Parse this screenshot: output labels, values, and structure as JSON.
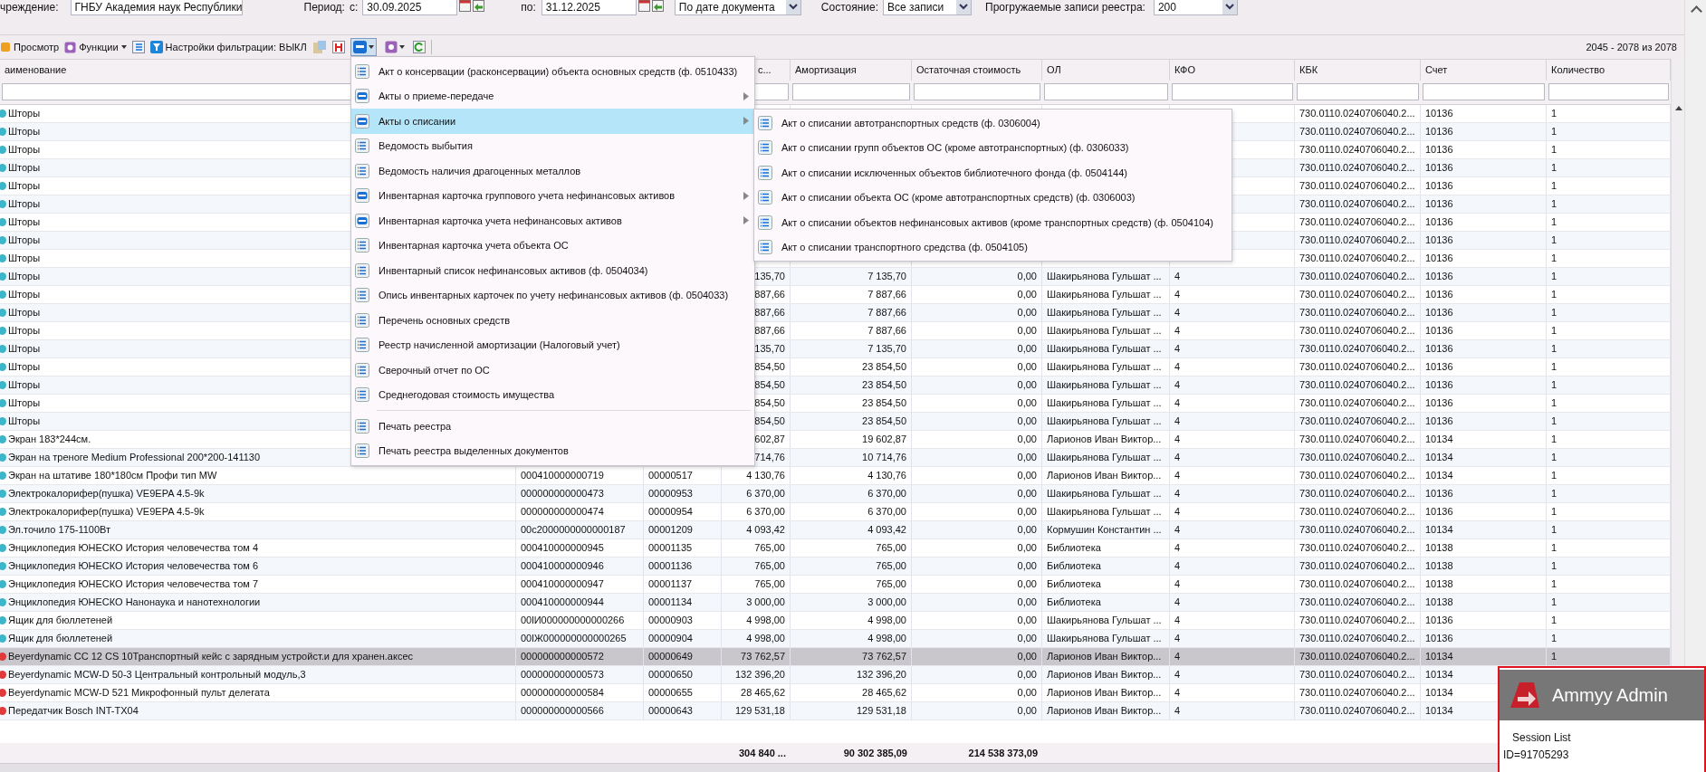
{
  "filter_bar": [
    {
      "kind": "label",
      "text": "чреждение:"
    },
    {
      "kind": "field",
      "text": "ГНБУ Академия наук Республики"
    },
    {
      "kind": "label",
      "text": "Период:"
    },
    {
      "kind": "label",
      "text": "с:"
    },
    {
      "kind": "date",
      "text": "30.09.2025"
    },
    {
      "kind": "label",
      "text": "по:"
    },
    {
      "kind": "date",
      "text": "31.12.2025"
    },
    {
      "kind": "select",
      "text": "По дате документа"
    },
    {
      "kind": "label",
      "text": "Состояние:"
    },
    {
      "kind": "select",
      "text": "Все записи"
    },
    {
      "kind": "label",
      "text": "Прогружаемые записи реестра:"
    },
    {
      "kind": "select",
      "text": "200"
    }
  ],
  "toolbar": {
    "view_button": "Просмотр",
    "functions_button": "Функции",
    "filter_settings": "Настройки фильтрации: ВЫКЛ",
    "print_pressed": true,
    "pager": "2045 - 2078 из 2078"
  },
  "columns": [
    "аименование",
    null,
    null,
    "с...",
    "Амортизация",
    "Остаточная стоимость",
    "ОЛ",
    "КФО",
    "КБК",
    "Счет",
    "Количество"
  ],
  "rows": [
    {
      "color": "#3cb6c8",
      "selected": false,
      "cells": [
        "Шторы",
        null,
        null,
        null,
        null,
        null,
        null,
        null,
        "730.0110.0240706040.2...",
        "10136",
        "1"
      ]
    },
    {
      "color": "#3cb6c8",
      "selected": false,
      "cells": [
        "Шторы",
        null,
        null,
        null,
        null,
        null,
        null,
        null,
        "730.0110.0240706040.2...",
        "10136",
        "1"
      ]
    },
    {
      "color": "#3cb6c8",
      "selected": false,
      "cells": [
        "Шторы",
        null,
        null,
        null,
        null,
        null,
        null,
        null,
        "730.0110.0240706040.2...",
        "10136",
        "1"
      ]
    },
    {
      "color": "#3cb6c8",
      "selected": false,
      "cells": [
        "Шторы",
        null,
        null,
        null,
        null,
        null,
        null,
        null,
        "730.0110.0240706040.2...",
        "10136",
        "1"
      ]
    },
    {
      "color": "#3cb6c8",
      "selected": false,
      "cells": [
        "Шторы",
        null,
        null,
        null,
        null,
        null,
        null,
        null,
        "730.0110.0240706040.2...",
        "10136",
        "1"
      ]
    },
    {
      "color": "#3cb6c8",
      "selected": false,
      "cells": [
        "Шторы",
        null,
        null,
        null,
        null,
        null,
        null,
        null,
        "730.0110.0240706040.2...",
        "10136",
        "1"
      ]
    },
    {
      "color": "#3cb6c8",
      "selected": false,
      "cells": [
        "Шторы",
        null,
        null,
        null,
        null,
        null,
        null,
        null,
        "730.0110.0240706040.2...",
        "10136",
        "1"
      ]
    },
    {
      "color": "#3cb6c8",
      "selected": false,
      "cells": [
        "Шторы",
        null,
        null,
        null,
        null,
        null,
        null,
        null,
        "730.0110.0240706040.2...",
        "10136",
        "1"
      ]
    },
    {
      "color": "#3cb6c8",
      "selected": false,
      "cells": [
        "Шторы",
        null,
        null,
        null,
        null,
        null,
        null,
        null,
        "730.0110.0240706040.2...",
        "10136",
        "1"
      ]
    },
    {
      "color": "#3cb6c8",
      "selected": false,
      "cells": [
        "Шторы",
        null,
        null,
        "135,70",
        "7 135,70",
        "0,00",
        "Шакирьянова Гульшат ...",
        "4",
        "730.0110.0240706040.2...",
        "10136",
        "1"
      ]
    },
    {
      "color": "#3cb6c8",
      "selected": false,
      "cells": [
        "Шторы",
        null,
        null,
        "887,66",
        "7 887,66",
        "0,00",
        "Шакирьянова Гульшат ...",
        "4",
        "730.0110.0240706040.2...",
        "10136",
        "1"
      ]
    },
    {
      "color": "#3cb6c8",
      "selected": false,
      "cells": [
        "Шторы",
        null,
        null,
        "887,66",
        "7 887,66",
        "0,00",
        "Шакирьянова Гульшат ...",
        "4",
        "730.0110.0240706040.2...",
        "10136",
        "1"
      ]
    },
    {
      "color": "#3cb6c8",
      "selected": false,
      "cells": [
        "Шторы",
        null,
        null,
        "887,66",
        "7 887,66",
        "0,00",
        "Шакирьянова Гульшат ...",
        "4",
        "730.0110.0240706040.2...",
        "10136",
        "1"
      ]
    },
    {
      "color": "#3cb6c8",
      "selected": false,
      "cells": [
        "Шторы",
        null,
        null,
        "135,70",
        "7 135,70",
        "0,00",
        "Шакирьянова Гульшат ...",
        "4",
        "730.0110.0240706040.2...",
        "10136",
        "1"
      ]
    },
    {
      "color": "#3cb6c8",
      "selected": false,
      "cells": [
        "Шторы",
        null,
        null,
        "854,50",
        "23 854,50",
        "0,00",
        "Шакирьянова Гульшат ...",
        "4",
        "730.0110.0240706040.2...",
        "10136",
        "1"
      ]
    },
    {
      "color": "#3cb6c8",
      "selected": false,
      "cells": [
        "Шторы",
        null,
        null,
        "854,50",
        "23 854,50",
        "0,00",
        "Шакирьянова Гульшат ...",
        "4",
        "730.0110.0240706040.2...",
        "10136",
        "1"
      ]
    },
    {
      "color": "#3cb6c8",
      "selected": false,
      "cells": [
        "Шторы",
        null,
        null,
        "854,50",
        "23 854,50",
        "0,00",
        "Шакирьянова Гульшат ...",
        "4",
        "730.0110.0240706040.2...",
        "10136",
        "1"
      ]
    },
    {
      "color": "#3cb6c8",
      "selected": false,
      "cells": [
        "Шторы",
        null,
        null,
        "854,50",
        "23 854,50",
        "0,00",
        "Шакирьянова Гульшат ...",
        "4",
        "730.0110.0240706040.2...",
        "10136",
        "1"
      ]
    },
    {
      "color": "#3cb6c8",
      "selected": false,
      "cells": [
        "Экран 183*244см.",
        null,
        null,
        "602,87",
        "19 602,87",
        "0,00",
        "Ларионов Иван Виктор...",
        "4",
        "730.0110.0240706040.2...",
        "10134",
        "1"
      ]
    },
    {
      "color": "#3cb6c8",
      "selected": false,
      "cells": [
        "Экран на треноге Medium Professional 200*200-141130",
        null,
        null,
        "714,76",
        "10 714,76",
        "0,00",
        "Шакирьянова Гульшат ...",
        "4",
        "730.0110.0240706040.2...",
        "10134",
        "1"
      ]
    },
    {
      "color": "#3cb6c8",
      "selected": false,
      "cells": [
        "Экран на штативе 180*180см Профи тип MW",
        "000410000000719",
        "00000517",
        "4 130,76",
        "4 130,76",
        "0,00",
        "Ларионов Иван Виктор...",
        "4",
        "730.0110.0240706040.2...",
        "10134",
        "1"
      ]
    },
    {
      "color": "#3cb6c8",
      "selected": false,
      "cells": [
        "Электрокалорифер(пушка) VE9EPA 4.5-9k",
        "000000000000473",
        "00000953",
        "6 370,00",
        "6 370,00",
        "0,00",
        "Шакирьянова Гульшат ...",
        "4",
        "730.0110.0240706040.2...",
        "10136",
        "1"
      ]
    },
    {
      "color": "#3cb6c8",
      "selected": false,
      "cells": [
        "Электрокалорифер(пушка) VE9EPA 4.5-9k",
        "000000000000474",
        "00000954",
        "6 370,00",
        "6 370,00",
        "0,00",
        "Шакирьянова Гульшат ...",
        "4",
        "730.0110.0240706040.2...",
        "10136",
        "1"
      ]
    },
    {
      "color": "#3cb6c8",
      "selected": false,
      "cells": [
        "Эл.точило 175-1100Вт",
        "00c2000000000000187",
        "00001209",
        "4 093,42",
        "4 093,42",
        "0,00",
        "Кормушин Константин ...",
        "4",
        "730.0110.0240706040.2...",
        "10134",
        "1"
      ]
    },
    {
      "color": "#3cb6c8",
      "selected": false,
      "cells": [
        "Энциклопедия ЮНЕСКО История человечества том 4",
        "000410000000945",
        "00001135",
        "765,00",
        "765,00",
        "0,00",
        "Библиотека",
        "4",
        "730.0110.0240706040.2...",
        "10138",
        "1"
      ]
    },
    {
      "color": "#3cb6c8",
      "selected": false,
      "cells": [
        "Энциклопедия ЮНЕСКО История человечества том 6",
        "000410000000946",
        "00001136",
        "765,00",
        "765,00",
        "0,00",
        "Библиотека",
        "4",
        "730.0110.0240706040.2...",
        "10138",
        "1"
      ]
    },
    {
      "color": "#3cb6c8",
      "selected": false,
      "cells": [
        "Энциклопедия ЮНЕСКО История человечества том 7",
        "000410000000947",
        "00001137",
        "765,00",
        "765,00",
        "0,00",
        "Библиотека",
        "4",
        "730.0110.0240706040.2...",
        "10138",
        "1"
      ]
    },
    {
      "color": "#3cb6c8",
      "selected": false,
      "cells": [
        "Энциклопедия ЮНЕСКО Нанонаука и нанотехнологии",
        "000410000000944",
        "00001134",
        "3 000,00",
        "3 000,00",
        "0,00",
        "Библиотека",
        "4",
        "730.0110.0240706040.2...",
        "10138",
        "1"
      ]
    },
    {
      "color": "#3cb6c8",
      "selected": false,
      "cells": [
        "Ящик для бюллетеней",
        "00lИ000000000000266",
        "00000903",
        "4 998,00",
        "4 998,00",
        "0,00",
        "Шакирьянова Гульшат ...",
        "4",
        "730.0110.0240706040.2...",
        "10136",
        "1"
      ]
    },
    {
      "color": "#3cb6c8",
      "selected": false,
      "cells": [
        "Ящик для бюллетеней",
        "00lЖ000000000000265",
        "00000904",
        "4 998,00",
        "4 998,00",
        "0,00",
        "Шакирьянова Гульшат ...",
        "4",
        "730.0110.0240706040.2...",
        "10136",
        "1"
      ]
    },
    {
      "color": "#e03a3a",
      "selected": true,
      "cells": [
        "Beyerdynamic CC 12 CS 10Транспортный кейс с зарядным устройст.и для хранен.аксес",
        "000000000000572",
        "00000649",
        "73 762,57",
        "73 762,57",
        "0,00",
        "Ларионов Иван Виктор...",
        "4",
        "730.0110.0240706040.2...",
        "10134",
        "1"
      ]
    },
    {
      "color": "#e03a3a",
      "selected": false,
      "cells": [
        "Beyerdynamic MCW-D 50-3 Центральный контрольный модуль,3",
        "000000000000573",
        "00000650",
        "132 396,20",
        "132 396,20",
        "0,00",
        "Ларионов Иван Виктор...",
        "4",
        "730.0110.0240706040.2...",
        "10134",
        null
      ]
    },
    {
      "color": "#e03a3a",
      "selected": false,
      "cells": [
        "Beyerdynamic MCW-D 521 Микрофонный пульт делегата",
        "000000000000584",
        "00000655",
        "28 465,62",
        "28 465,62",
        "0,00",
        "Ларионов Иван Виктор...",
        "4",
        "730.0110.0240706040.2...",
        "10134",
        null
      ]
    },
    {
      "color": "#e03a3a",
      "selected": false,
      "cells": [
        "Передатчик Bosch INT-TX04",
        "000000000000566",
        "00000643",
        "129 531,18",
        "129 531,18",
        "0,00",
        "Ларионов Иван Виктор...",
        "4",
        "730.0110.0240706040.2...",
        "10134",
        null
      ]
    }
  ],
  "totals": [
    "304 840 ...",
    "90 302 385,09",
    "214 538 373,09"
  ],
  "print_menu": {
    "items": [
      {
        "label": "Акт о консервации (расконсервации) объекта основных средств (ф. 0510433)",
        "kind": "list",
        "submenu": false,
        "selected": false
      },
      {
        "label": "Акты о приеме-передаче",
        "kind": "printer",
        "submenu": true,
        "selected": false
      },
      {
        "label": "Акты о списании",
        "kind": "printer",
        "submenu": true,
        "selected": true
      },
      {
        "label": "Ведомость выбытия",
        "kind": "list",
        "submenu": false,
        "selected": false
      },
      {
        "label": "Ведомость наличия драгоценных металлов",
        "kind": "list",
        "submenu": false,
        "selected": false
      },
      {
        "label": "Инвентарная карточка группового учета нефинансовых активов",
        "kind": "printer",
        "submenu": true,
        "selected": false
      },
      {
        "label": "Инвентарная карточка учета нефинансовых активов",
        "kind": "printer",
        "submenu": true,
        "selected": false
      },
      {
        "label": "Инвентарная карточка учета объекта ОС",
        "kind": "list",
        "submenu": false,
        "selected": false
      },
      {
        "label": "Инвентарный список нефинансовых активов (ф. 0504034)",
        "kind": "list",
        "submenu": false,
        "selected": false
      },
      {
        "label": "Опись инвентарных карточек по учету нефинансовых активов (ф. 0504033)",
        "kind": "list",
        "submenu": false,
        "selected": false
      },
      {
        "label": "Перечень основных средств",
        "kind": "list",
        "submenu": false,
        "selected": false
      },
      {
        "label": "Реестр начисленной амортизации (Налоговый учет)",
        "kind": "list",
        "submenu": false,
        "selected": false
      },
      {
        "label": "Сверочный отчет по ОС",
        "kind": "list",
        "submenu": false,
        "selected": false
      },
      {
        "label": "Среднегодовая стоимость имущества",
        "kind": "list",
        "submenu": false,
        "selected": false
      }
    ],
    "print_items": [
      {
        "label": "Печать реестра",
        "kind": "list",
        "submenu": false,
        "selected": false
      },
      {
        "label": "Печать реестра выделенных документов",
        "kind": "list",
        "submenu": false,
        "selected": false
      }
    ],
    "submenu": [
      {
        "label": "Акт о списании автотранспортных средств (ф. 0306004)",
        "kind": "list"
      },
      {
        "label": "Акт о списании групп объектов ОС (кроме автотранспортных) (ф. 0306033)",
        "kind": "list"
      },
      {
        "label": "Акт о списании исключенных объектов библиотечного фонда (ф. 0504144)",
        "kind": "list"
      },
      {
        "label": "Акт о списании объекта ОС (кроме автотранспортных средств) (ф. 0306003)",
        "kind": "list"
      },
      {
        "label": "Акт о списании объектов нефинансовых активов (кроме транспортных средств) (ф. 0504104)",
        "kind": "list"
      },
      {
        "label": "Акт о списании транспортного средства (ф. 0504105)",
        "kind": "list"
      }
    ]
  },
  "remote_panel": {
    "title": "Ammyy Admin",
    "link": "Session List",
    "id": "ID=91705293"
  }
}
